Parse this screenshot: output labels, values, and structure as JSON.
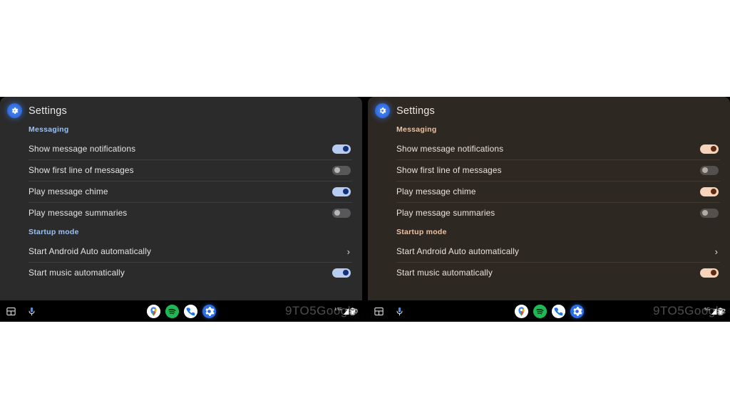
{
  "panels": [
    {
      "id": "left",
      "theme_name": "blue",
      "accent": "#9ec1f0",
      "toggle_on_track": "#b8ccf2",
      "toggle_on_knob": "#15307a",
      "background": "#2b2b2b",
      "app_title": "Settings",
      "gear_icon": "gear-icon",
      "sections": [
        {
          "header": "Messaging",
          "rows": [
            {
              "label": "Show message notifications",
              "control": "toggle",
              "state": "on"
            },
            {
              "label": "Show first line of messages",
              "control": "toggle",
              "state": "off"
            },
            {
              "label": "Play message chime",
              "control": "toggle",
              "state": "on"
            },
            {
              "label": "Play message summaries",
              "control": "toggle",
              "state": "off"
            }
          ]
        },
        {
          "header": "Startup mode",
          "rows": [
            {
              "label": "Start Android Auto automatically",
              "control": "chevron",
              "chevron": "›"
            },
            {
              "label": "Start music automatically",
              "control": "toggle",
              "state": "on"
            }
          ]
        }
      ],
      "sysbar": {
        "apps_icon": "apps-grid-icon",
        "mic_icon": "microphone-icon",
        "dock": [
          {
            "name": "maps-app-icon",
            "label": "Maps"
          },
          {
            "name": "spotify-app-icon",
            "label": "Spotify"
          },
          {
            "name": "phone-app-icon",
            "label": "Phone"
          },
          {
            "name": "settings-app-icon",
            "label": "Settings"
          }
        ],
        "watermark": "9TO5Google",
        "network": "LTE",
        "clock": "2:00"
      }
    },
    {
      "id": "right",
      "theme_name": "peach",
      "accent": "#e9c2a6",
      "toggle_on_track": "#f7d3bb",
      "toggle_on_knob": "#5c2c12",
      "background": "#2e2823",
      "app_title": "Settings",
      "gear_icon": "gear-icon",
      "sections": [
        {
          "header": "Messaging",
          "rows": [
            {
              "label": "Show message notifications",
              "control": "toggle",
              "state": "on"
            },
            {
              "label": "Show first line of messages",
              "control": "toggle",
              "state": "off"
            },
            {
              "label": "Play message chime",
              "control": "toggle",
              "state": "on"
            },
            {
              "label": "Play message summaries",
              "control": "toggle",
              "state": "off"
            }
          ]
        },
        {
          "header": "Startup mode",
          "rows": [
            {
              "label": "Start Android Auto automatically",
              "control": "chevron",
              "chevron": "›"
            },
            {
              "label": "Start music automatically",
              "control": "toggle",
              "state": "on"
            }
          ]
        }
      ],
      "sysbar": {
        "apps_icon": "apps-grid-icon",
        "mic_icon": "microphone-icon",
        "dock": [
          {
            "name": "maps-app-icon",
            "label": "Maps"
          },
          {
            "name": "spotify-app-icon",
            "label": "Spotify"
          },
          {
            "name": "phone-app-icon",
            "label": "Phone"
          },
          {
            "name": "settings-app-icon",
            "label": "Settings"
          }
        ],
        "watermark": "9TO5Google",
        "network": "5G",
        "clock": "2:02"
      }
    }
  ]
}
